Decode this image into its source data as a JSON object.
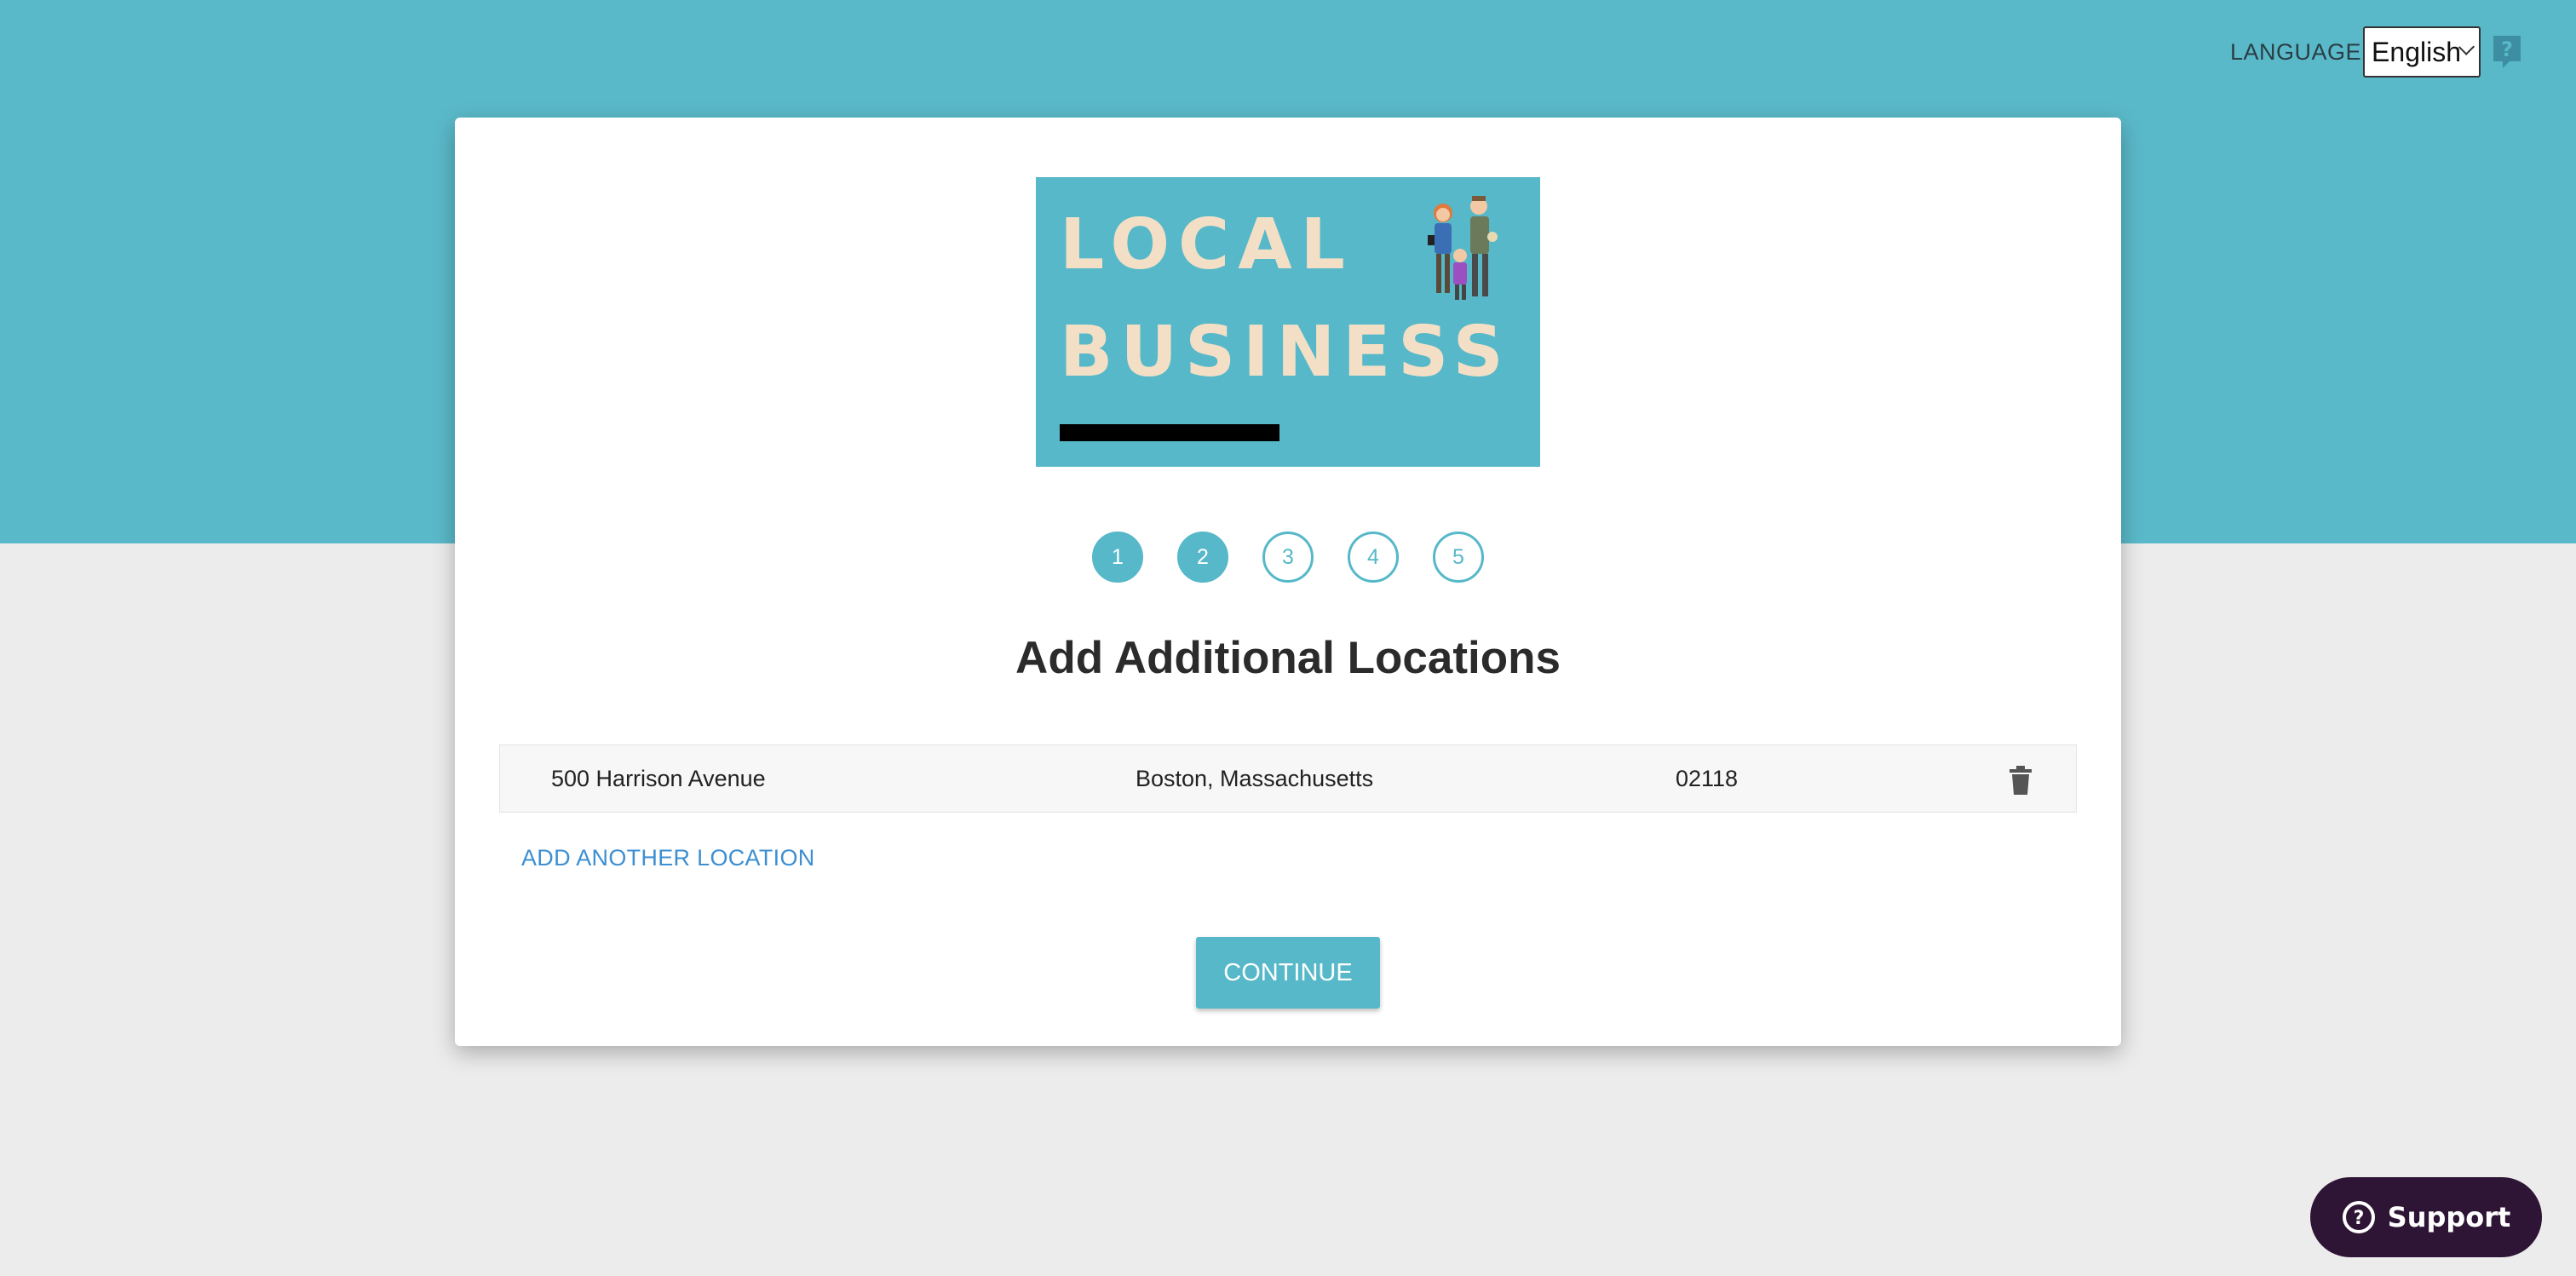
{
  "header": {
    "language_label": "LANGUAGE",
    "language_value": "English"
  },
  "logo": {
    "line1": "LOCAL",
    "line2": "BUSINESS"
  },
  "steps": [
    "1",
    "2",
    "3",
    "4",
    "5"
  ],
  "steps_completed": 2,
  "title": "Add Additional Locations",
  "locations": [
    {
      "street": "500 Harrison Avenue",
      "city_state": "Boston, Massachusetts",
      "zip": "02118"
    }
  ],
  "add_location_label": "ADD ANOTHER LOCATION",
  "continue_label": "CONTINUE",
  "support_label": "Support",
  "colors": {
    "brand": "#56b8c8",
    "link": "#3d8fd1",
    "support_bg": "#2e1535"
  }
}
